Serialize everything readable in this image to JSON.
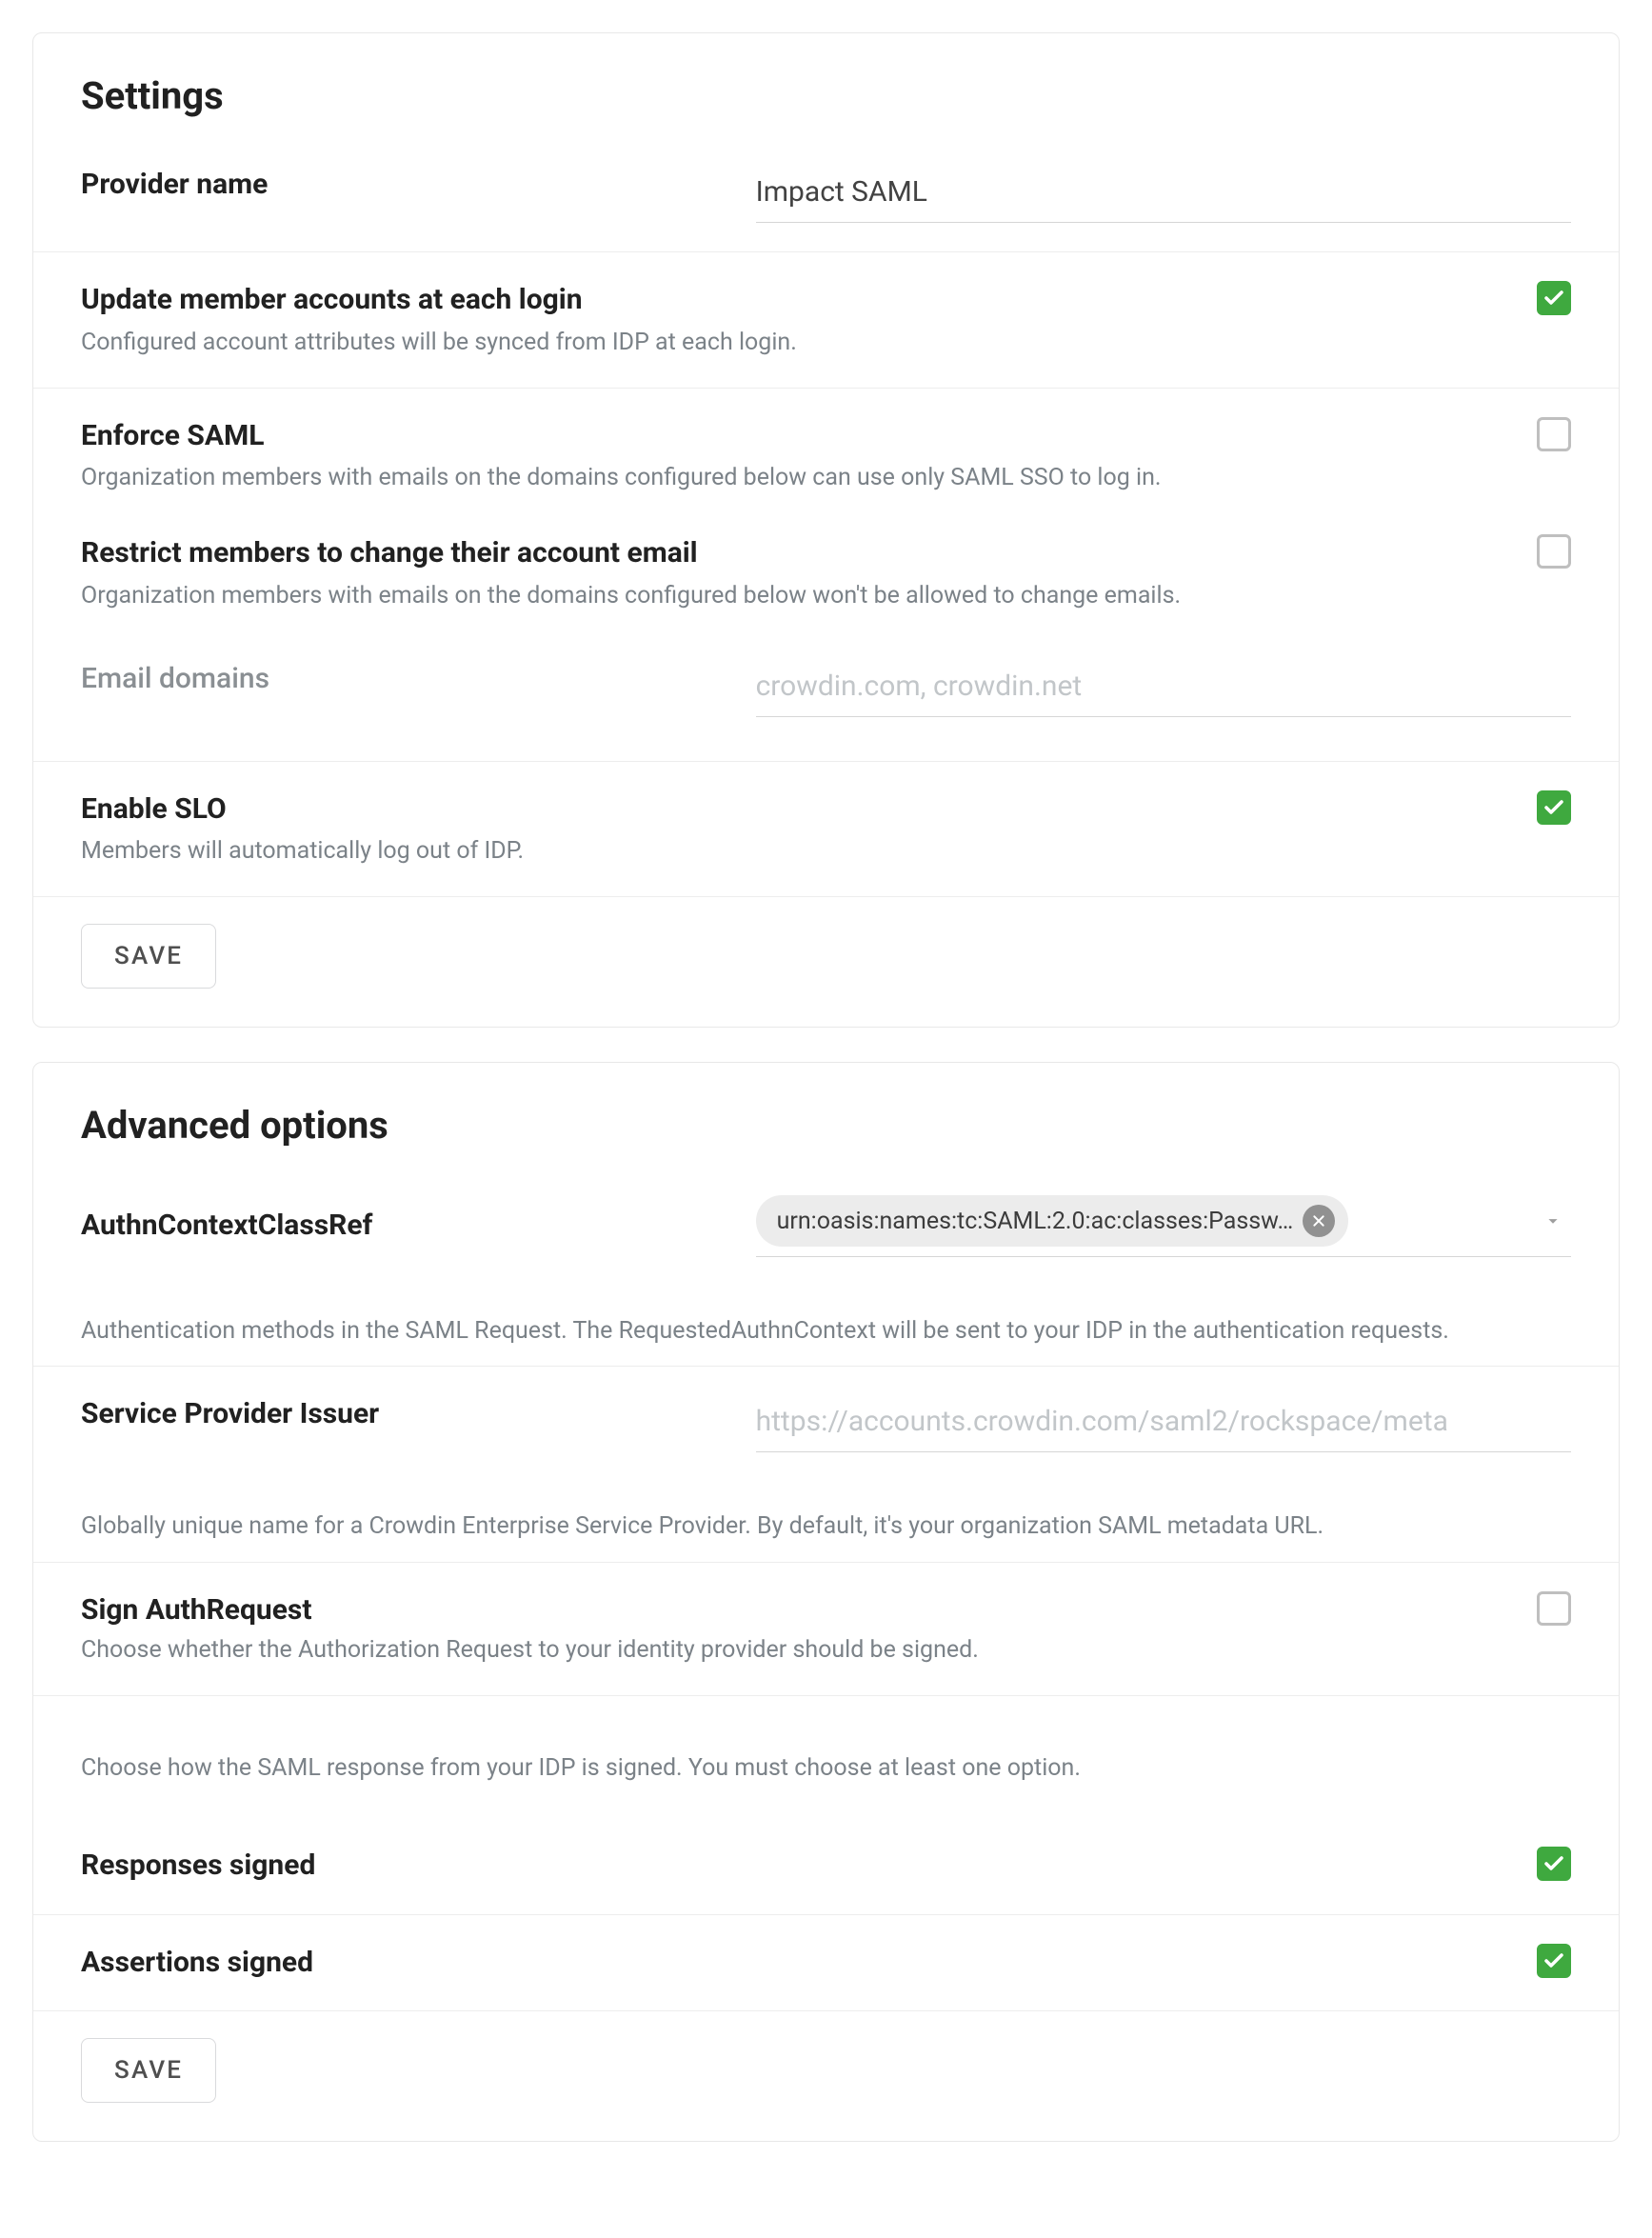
{
  "settings": {
    "title": "Settings",
    "provider_name": {
      "label": "Provider name",
      "value": "Impact SAML"
    },
    "update_members": {
      "label": "Update member accounts at each login",
      "desc": "Configured account attributes will be synced from IDP at each login.",
      "checked": true
    },
    "enforce_saml": {
      "label": "Enforce SAML",
      "desc": "Organization members with emails on the domains configured below can use only SAML SSO to log in.",
      "checked": false
    },
    "restrict_email": {
      "label": "Restrict members to change their account email",
      "desc": "Organization members with emails on the domains configured below won't be allowed to change emails.",
      "checked": false
    },
    "email_domains": {
      "label": "Email domains",
      "placeholder": "crowdin.com, crowdin.net",
      "value": ""
    },
    "enable_slo": {
      "label": "Enable SLO",
      "desc": "Members will automatically log out of IDP.",
      "checked": true
    },
    "save_label": "SAVE"
  },
  "advanced": {
    "title": "Advanced options",
    "authn": {
      "label": "AuthnContextClassRef",
      "chip": "urn:oasis:names:tc:SAML:2.0:ac:classes:Passw…",
      "desc": "Authentication methods in the SAML Request. The RequestedAuthnContext will be sent to your IDP in the authentication requests."
    },
    "sp_issuer": {
      "label": "Service Provider Issuer",
      "placeholder": "https://accounts.crowdin.com/saml2/rockspace/meta",
      "value": "",
      "desc": "Globally unique name for a Crowdin Enterprise Service Provider. By default, it's your organization SAML metadata URL."
    },
    "sign_authreq": {
      "label": "Sign AuthRequest",
      "desc": "Choose whether the Authorization Request to your identity provider should be signed.",
      "checked": false
    },
    "response_intro": "Choose how the SAML response from your IDP is signed. You must choose at least one option.",
    "responses_signed": {
      "label": "Responses signed",
      "checked": true
    },
    "assertions_signed": {
      "label": "Assertions signed",
      "checked": true
    },
    "save_label": "SAVE"
  }
}
